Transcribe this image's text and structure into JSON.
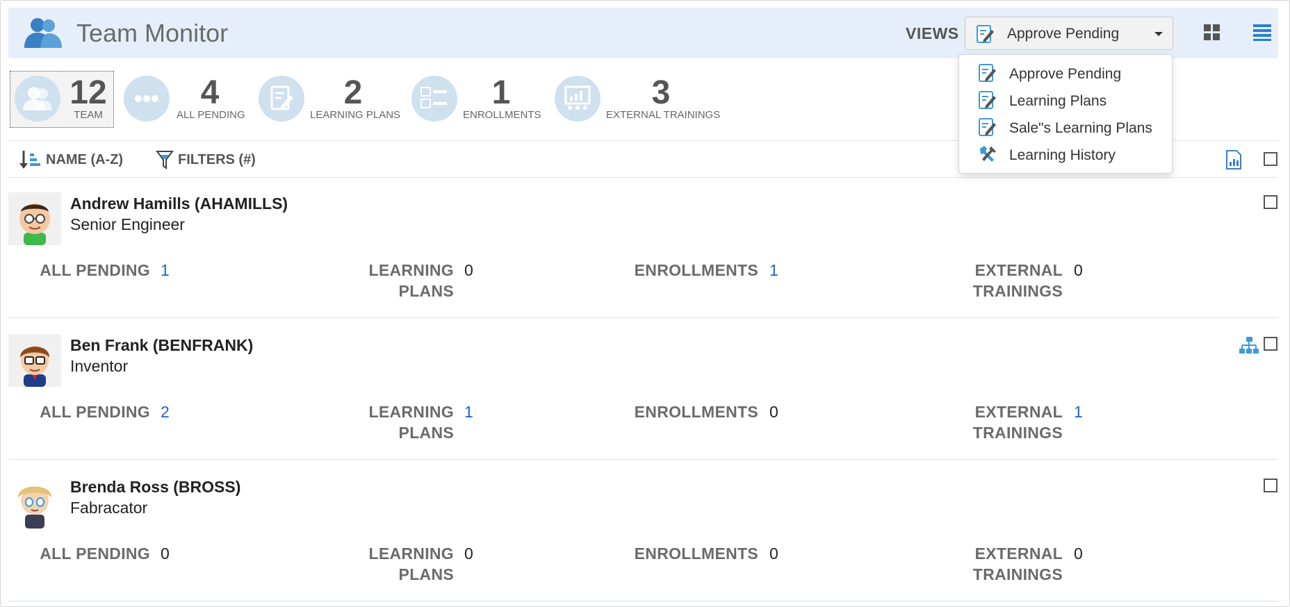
{
  "header": {
    "title": "Team Monitor",
    "views_label": "VIEWS",
    "selected_view": "Approve Pending",
    "icons": {
      "logo": "team-users-icon",
      "grid": "grid-view-icon",
      "list": "list-view-icon"
    }
  },
  "dropdown": {
    "items": [
      {
        "label": "Approve Pending",
        "icon": "edit-document-icon"
      },
      {
        "label": "Learning Plans",
        "icon": "edit-document-icon"
      },
      {
        "label": "Sale\"s Learning Plans",
        "icon": "edit-document-icon"
      },
      {
        "label": "Learning History",
        "icon": "tools-icon"
      }
    ]
  },
  "summary": {
    "team": {
      "count": "12",
      "label": "TEAM"
    },
    "all_pending": {
      "count": "4",
      "label": "ALL PENDING"
    },
    "learning_plans": {
      "count": "2",
      "label": "LEARNING PLANS"
    },
    "enrollments": {
      "count": "1",
      "label": "ENROLLMENTS"
    },
    "external_trainings": {
      "count": "3",
      "label": "EXTERNAL TRAININGS"
    }
  },
  "toolbar": {
    "sort_label": "NAME (A-Z)",
    "filter_label": "FILTERS (#)"
  },
  "metric_labels": {
    "all_pending": "ALL PENDING",
    "learning_plans_1": "LEARNING",
    "learning_plans_2": "PLANS",
    "enrollments": "ENROLLMENTS",
    "external_1": "EXTERNAL",
    "external_2": "TRAININGS"
  },
  "people": [
    {
      "name": "Andrew Hamills (AHAMILLS)",
      "role": "Senior Engineer",
      "all_pending": "1",
      "learning_plans": "0",
      "enrollments": "1",
      "external_trainings": "0"
    },
    {
      "name": "Ben Frank (BENFRANK)",
      "role": "Inventor",
      "all_pending": "2",
      "learning_plans": "1",
      "enrollments": "0",
      "external_trainings": "1"
    },
    {
      "name": "Brenda Ross (BROSS)",
      "role": "Fabracator",
      "all_pending": "0",
      "learning_plans": "0",
      "enrollments": "0",
      "external_trainings": "0"
    }
  ],
  "colors": {
    "header_bg": "#e6eff9",
    "link": "#1f63c4",
    "circle": "#cfe0ef"
  }
}
